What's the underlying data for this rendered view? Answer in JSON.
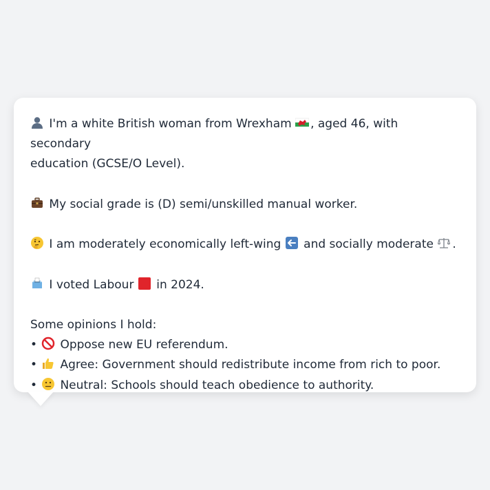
{
  "persona": {
    "intro_pre": "I'm a white British woman from Wrexham",
    "intro_post": ", aged 46, with secondary",
    "intro_line2": "education (GCSE/O Level).",
    "social_grade": "My social grade is (D) semi/unskilled manual worker.",
    "economic_pre": "I am moderately economically left-wing",
    "economic_mid": "and socially moderate",
    "economic_end": ".",
    "vote_pre": "I voted Labour",
    "vote_post": "in 2024.",
    "opinions_heading": "Some opinions I hold:",
    "bullet": "•",
    "opinions": [
      "Oppose new EU referendum.",
      "Agree: Government should redistribute income from rich to poor.",
      "Neutral: Schools should teach obedience to authority."
    ]
  },
  "icons": {
    "person": "person-silhouette-icon",
    "flag": "wales-flag-icon",
    "briefcase": "briefcase-icon",
    "thinking": "thinking-face-icon",
    "left_arrow": "left-arrow-icon",
    "scales": "balance-scale-icon",
    "ballot": "ballot-box-icon",
    "red_square": "red-square-icon",
    "prohibited": "prohibited-icon",
    "thumbs_up": "thumbs-up-icon",
    "neutral_face": "neutral-face-icon"
  },
  "colors": {
    "background": "#f2f3f5",
    "card": "#ffffff",
    "text": "#1f2937",
    "labour_red": "#e0242b"
  }
}
